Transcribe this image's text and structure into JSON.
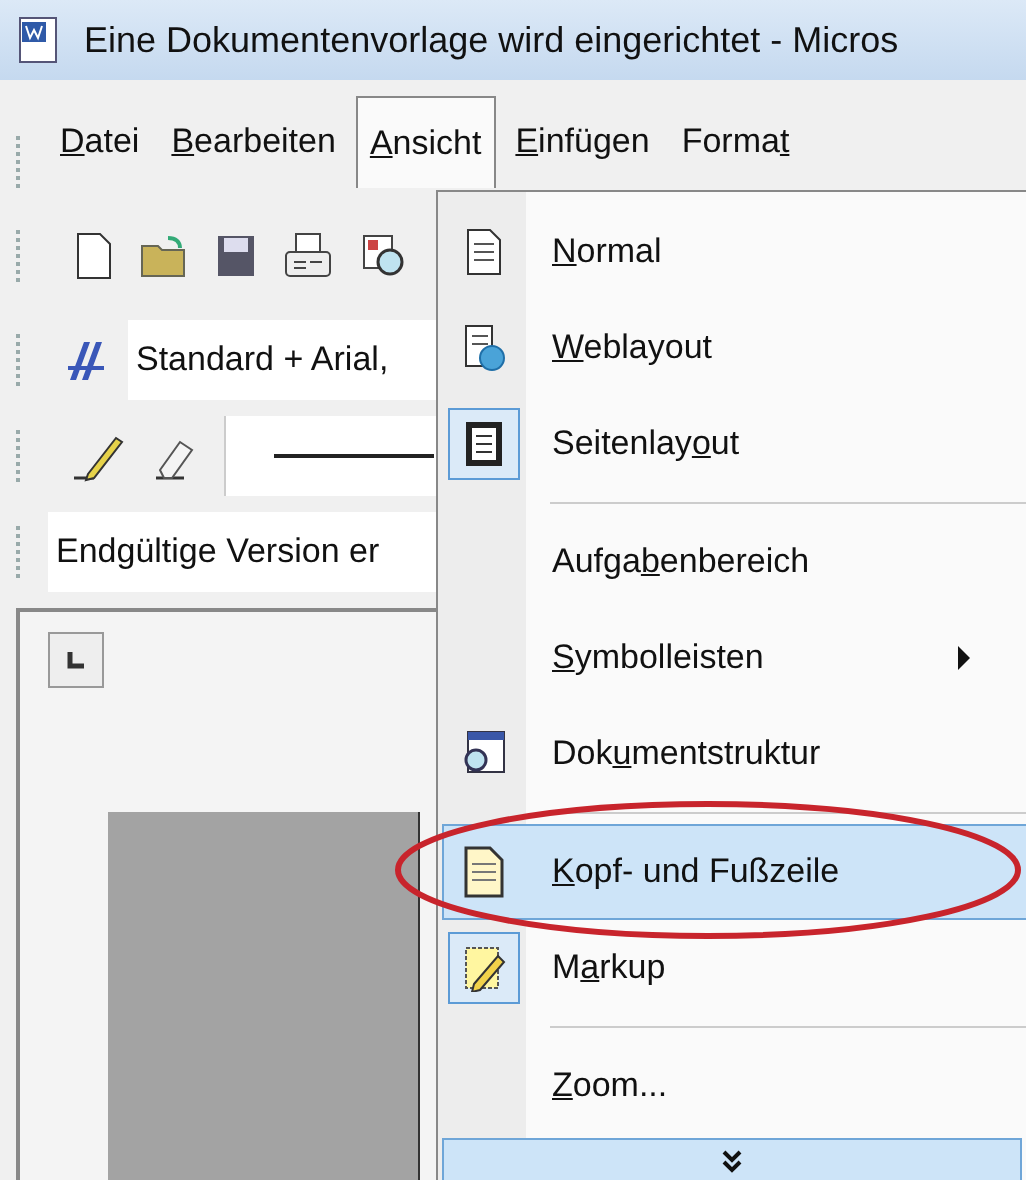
{
  "window": {
    "title": "Eine Dokumentenvorlage wird eingerichtet - Micros"
  },
  "menu_bar": [
    {
      "label": {
        "key": "D",
        "after": "atei"
      },
      "selected": false
    },
    {
      "label": {
        "key": "B",
        "after": "earbeiten"
      },
      "selected": false
    },
    {
      "label": {
        "key": "A",
        "after": "nsicht"
      },
      "selected": true
    },
    {
      "label": {
        "key": "E",
        "after": "infügen"
      },
      "selected": false
    },
    {
      "label": {
        "before": "Forma",
        "key": "t"
      },
      "selected": false
    }
  ],
  "style_field": {
    "value": "Standard + Arial,"
  },
  "review_field": {
    "value": "Endgültige Version er"
  },
  "view_menu": {
    "items": [
      {
        "kind": "item",
        "label": {
          "key": "N",
          "after": "ormal"
        },
        "checked": false,
        "selected": false,
        "submenu": false
      },
      {
        "kind": "item",
        "label": {
          "key": "W",
          "after": "eblayout"
        },
        "checked": false,
        "selected": false,
        "submenu": false
      },
      {
        "kind": "item",
        "label": {
          "before": "Seitenlay",
          "key": "o",
          "after": "ut"
        },
        "checked": true,
        "selected": false,
        "submenu": false
      },
      {
        "kind": "separator"
      },
      {
        "kind": "item",
        "label": {
          "before": "Aufga",
          "key": "b",
          "after": "enbereich"
        },
        "checked": false,
        "selected": false,
        "submenu": false
      },
      {
        "kind": "item",
        "label": {
          "key": "S",
          "after": "ymbolleisten"
        },
        "checked": false,
        "selected": false,
        "submenu": true
      },
      {
        "kind": "item",
        "label": {
          "before": "Dok",
          "key": "u",
          "after": "mentstruktur"
        },
        "checked": false,
        "selected": false,
        "submenu": false
      },
      {
        "kind": "separator"
      },
      {
        "kind": "item",
        "label": {
          "key": "K",
          "after": "opf- und Fußzeile"
        },
        "checked": false,
        "selected": true,
        "submenu": false
      },
      {
        "kind": "item",
        "label": {
          "before": "M",
          "key": "a",
          "after": "rkup"
        },
        "checked": true,
        "selected": false,
        "submenu": false
      },
      {
        "kind": "separator"
      },
      {
        "kind": "item",
        "label": {
          "key": "Z",
          "after": "oom..."
        },
        "checked": false,
        "selected": false,
        "submenu": false
      }
    ]
  }
}
